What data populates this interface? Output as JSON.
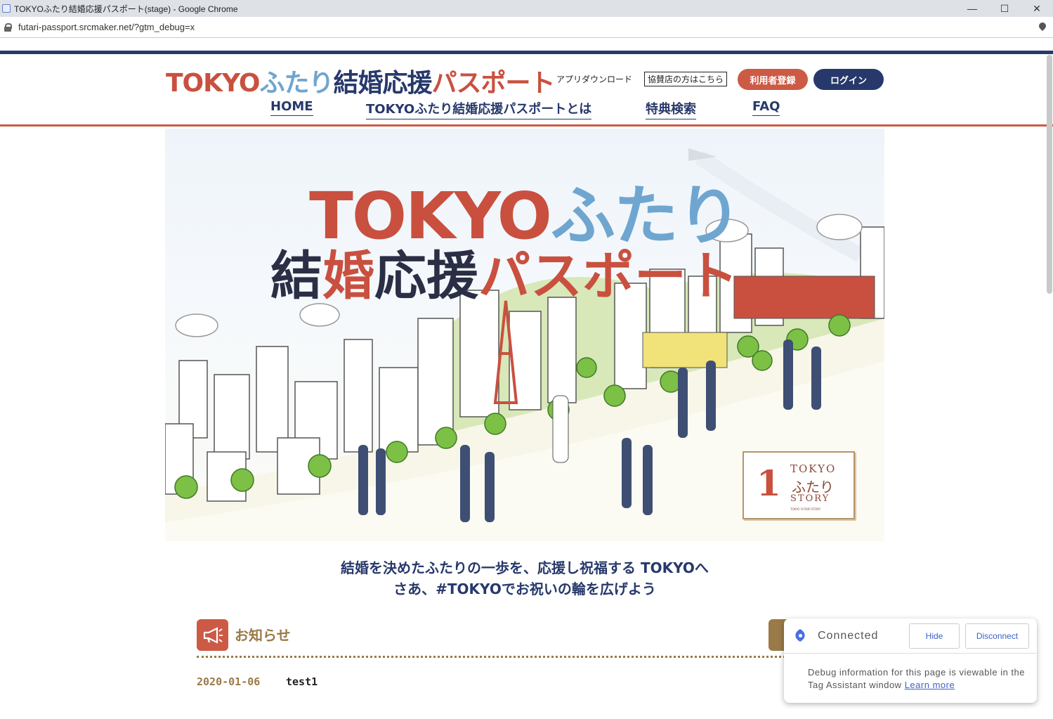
{
  "browser": {
    "tab_title": "TOKYOふたり結婚応援パスポート(stage) - Google Chrome",
    "url": "futari-passport.srcmaker.net/?gtm_debug=x",
    "minimize": "—",
    "maximize": "☐",
    "close": "✕"
  },
  "header": {
    "logo_tokyo": "TOKYO",
    "logo_futari": "ふたり",
    "logo_kekkon": "結婚応援",
    "logo_passport": "パスポート",
    "app_download": "アプリダウンロード",
    "shop_link": "協賛店の方はこちら",
    "register": "利用者登録",
    "login": "ログイン"
  },
  "nav": {
    "home": "HOME",
    "about": "TOKYOふたり結婚応援パスポートとは",
    "search": "特典検索",
    "faq": "FAQ"
  },
  "hero": {
    "title_tokyo": "TOKYO",
    "title_futari": "ふたり",
    "title_ke": "結",
    "title_kon": "婚",
    "title_ouen": "応援",
    "title_passport": "パスポート",
    "badge_number": "1",
    "badge_tokyo": "TOKYO",
    "badge_futari": "ふたり",
    "badge_story": "STORY",
    "badge_small": "TOKYO FUTARI STORY"
  },
  "tagline": {
    "line1": "結婚を決めたふたりの一歩を、応援し祝福する TOKYOへ",
    "line2": "さあ、#TOKYOでお祝いの輪を広げよう"
  },
  "news": {
    "icon": "megaphone-icon",
    "title": "お知らせ",
    "items": [
      {
        "date": "2020-01-06",
        "text": "test1"
      }
    ]
  },
  "tag_assistant": {
    "status": "Connected",
    "hide": "Hide",
    "disconnect": "Disconnect",
    "message": "Debug information for this page is viewable in the Tag Assistant window",
    "learn_more": "Learn more"
  },
  "colors": {
    "brand_red": "#cc5a45",
    "brand_navy": "#27396b",
    "brand_blue": "#6fa6cf",
    "gold": "#9a7a48"
  }
}
